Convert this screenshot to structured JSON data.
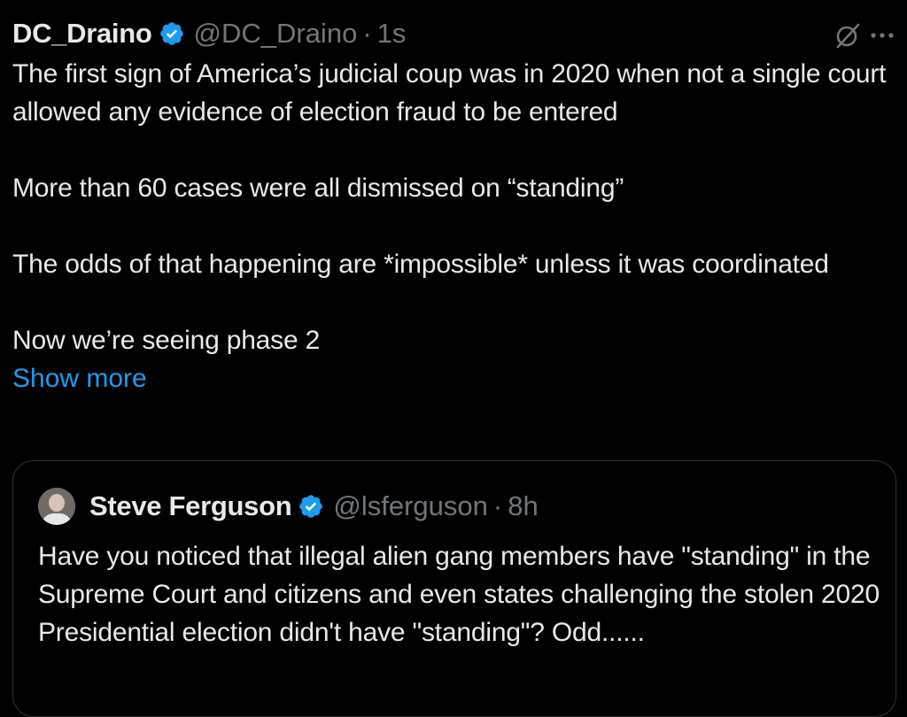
{
  "tweet": {
    "author_name": "DC_Draino",
    "author_handle": "@DC_Draino",
    "separator": "·",
    "time": "1s",
    "body": "The first sign of America’s judicial coup was in 2020 when not a single court allowed any evidence of election fraud to be entered\n\nMore than 60 cases were all dismissed on “standing”\n\nThe odds of that happening are *impossible* unless it was coordinated\n\nNow we’re seeing phase 2",
    "show_more_label": "Show more",
    "icons": {
      "verified": "verified-badge-icon",
      "grok": "grok-icon",
      "more": "more-icon"
    }
  },
  "quoted_tweet": {
    "author_name": "Steve Ferguson",
    "author_handle": "@lsferguson",
    "separator": "·",
    "time": "8h",
    "body": "Have you noticed that illegal alien gang members have \"standing\" in the Supreme Court and citizens and even states challenging the stolen 2020 Presidential election didn't have \"standing\"?  Odd......",
    "icons": {
      "avatar": "avatar",
      "verified": "verified-badge-icon"
    }
  },
  "colors": {
    "background": "#000000",
    "text": "#e7e9ea",
    "secondary_text": "#71767b",
    "link": "#1d9bf0",
    "verified": "#1d9bf0",
    "border": "#2f3336"
  }
}
